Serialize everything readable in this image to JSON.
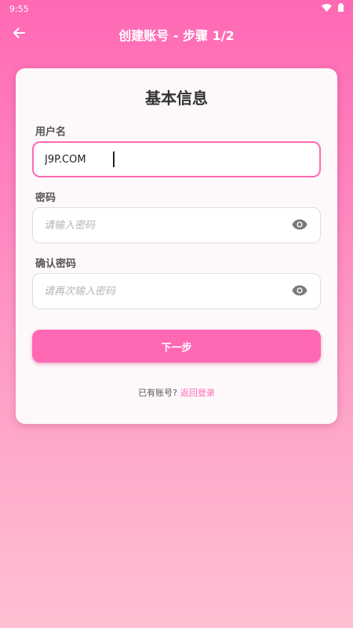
{
  "status_bar": {
    "time": "9:55",
    "icons": [
      "wifi-icon",
      "battery-icon"
    ]
  },
  "app_bar": {
    "back_icon": "arrow-back-icon",
    "title": "创建账号 - 步骤 1/2"
  },
  "card": {
    "title": "基本信息",
    "username": {
      "label": "用户名",
      "value": "J9P.COM",
      "placeholder": ""
    },
    "password": {
      "label": "密码",
      "value": "",
      "placeholder": "请输入密码",
      "toggle_icon": "eye-icon"
    },
    "confirm_password": {
      "label": "确认密码",
      "value": "",
      "placeholder": "请再次输入密码",
      "toggle_icon": "eye-icon"
    },
    "next_button": "下一步",
    "footer": {
      "prompt": "已有账号?",
      "link": "返回登录"
    }
  },
  "colors": {
    "accent": "#ff69b4",
    "background_top": "#ff69b4",
    "background_bottom": "#ffc0d2",
    "card": "#fdf8fa"
  }
}
